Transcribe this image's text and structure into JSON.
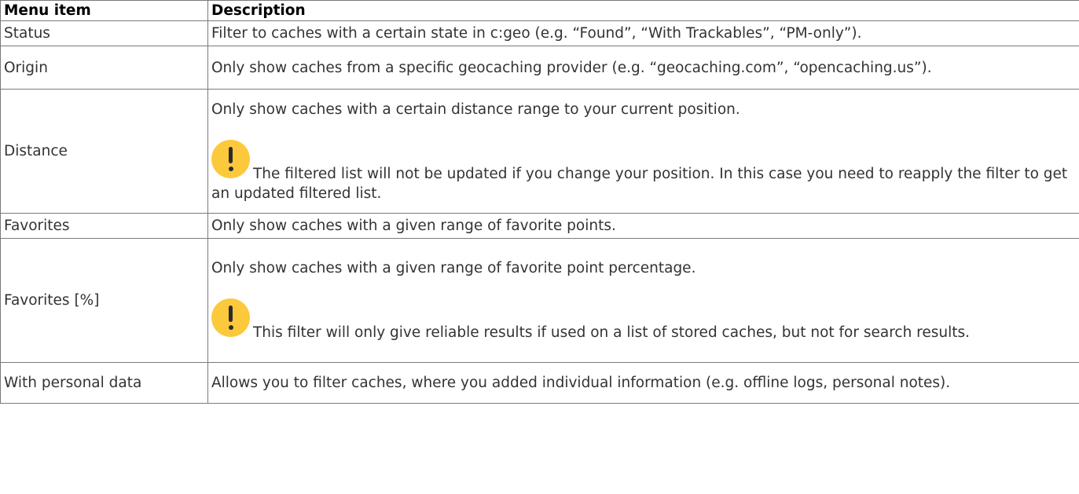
{
  "table": {
    "headers": [
      "Menu item",
      "Description"
    ],
    "rows": [
      {
        "item": "Status",
        "description": "Filter to caches with a certain state in c:geo (e.g. “Found”, “With Trackables”, “PM-only”)."
      },
      {
        "item": "Origin",
        "description": "Only show caches from a specific geocaching provider (e.g. “geocaching.com”, “opencaching.us”)."
      },
      {
        "item": "Distance",
        "description": "Only show caches with a certain distance range to your current position.",
        "note_icon": "warning-icon",
        "note": "The filtered list will not be updated if you change your position. In this case you need to reapply the filter to get an updated filtered list."
      },
      {
        "item": "Favorites",
        "description": "Only show caches with a given range of favorite points."
      },
      {
        "item": "Favorites [%]",
        "description": "Only show caches with a given range of favorite point percentage.",
        "note_icon": "warning-icon",
        "note": "This filter will only give reliable results if used on a list of stored caches, but not for search results."
      },
      {
        "item": "With personal data",
        "description": "Allows you to filter caches, where you added individual information (e.g. offline logs, personal notes)."
      }
    ]
  },
  "colors": {
    "warning": "#fcc93c",
    "border": "#7a7a7a",
    "text": "#333333"
  }
}
